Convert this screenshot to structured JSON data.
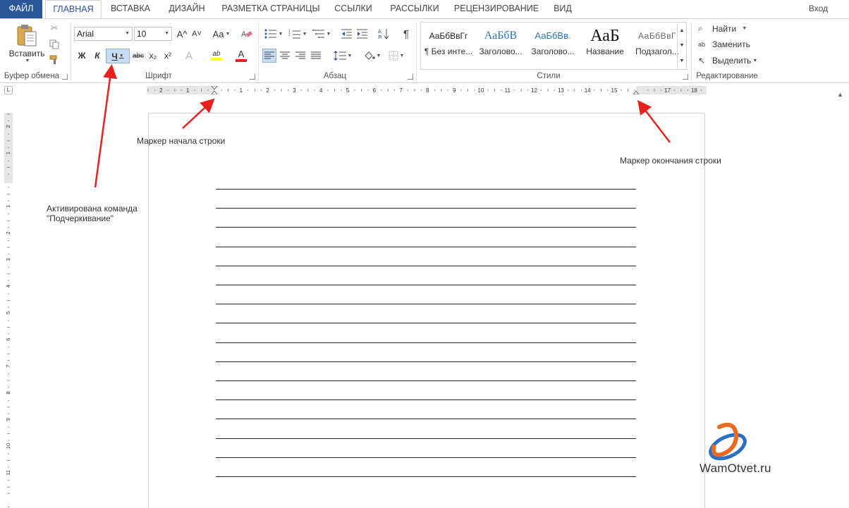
{
  "tabs": {
    "file": "ФАЙЛ",
    "home": "ГЛАВНАЯ",
    "insert": "ВСТАВКА",
    "design": "ДИЗАЙН",
    "layout": "РАЗМЕТКА СТРАНИЦЫ",
    "references": "ССЫЛКИ",
    "mailings": "РАССЫЛКИ",
    "review": "РЕЦЕНЗИРОВАНИЕ",
    "view": "ВИД"
  },
  "signin": "Вход",
  "clipboard": {
    "paste": "Вставить",
    "group": "Буфер обмена"
  },
  "font": {
    "name": "Arial",
    "size": "10",
    "bold": "Ж",
    "italic": "К",
    "underline": "Ч",
    "strike": "abc",
    "subscript": "x₂",
    "superscript": "x²",
    "grow": "A^",
    "shrink": "A˅",
    "case": "Aa",
    "effects": "A",
    "highlight": "ab",
    "color": "A",
    "group": "Шрифт"
  },
  "paragraph": {
    "group": "Абзац",
    "pilcrow": "¶"
  },
  "styles": {
    "group": "Стили",
    "items": [
      {
        "sample": "АаБбВвГг",
        "name": "¶ Без инте..."
      },
      {
        "sample": "АаБбВ",
        "name": "Заголово..."
      },
      {
        "sample": "АаБбВв.",
        "name": "Заголово..."
      },
      {
        "sample": "АаБ",
        "name": "Название"
      },
      {
        "sample": "АаБбВвГ",
        "name": "Подзагол..."
      }
    ]
  },
  "editing": {
    "group": "Редактирование",
    "find": "Найти",
    "replace": "Заменить",
    "select": "Выделить"
  },
  "ruler": {
    "h_labels": [
      "2",
      "1",
      "1",
      "2",
      "3",
      "4",
      "5",
      "6",
      "7",
      "8",
      "9",
      "10",
      "11",
      "12",
      "13",
      "14",
      "15",
      "17",
      "18"
    ],
    "v_labels": [
      "2",
      "1",
      "1",
      "2",
      "3",
      "4",
      "5",
      "6",
      "7",
      "8",
      "9",
      "10",
      "11"
    ]
  },
  "annotations": {
    "line_start": "Маркер начала строки",
    "line_end": "Маркер окончания строки",
    "underline_active": "Активирована команда\n\"Подчеркивание\""
  },
  "watermark": "WamOtvet.ru",
  "colors": {
    "file_tab": "#2b579a",
    "arrow": "#e8211c",
    "highlight": "#ffff00",
    "font_color": "#e8211c"
  }
}
